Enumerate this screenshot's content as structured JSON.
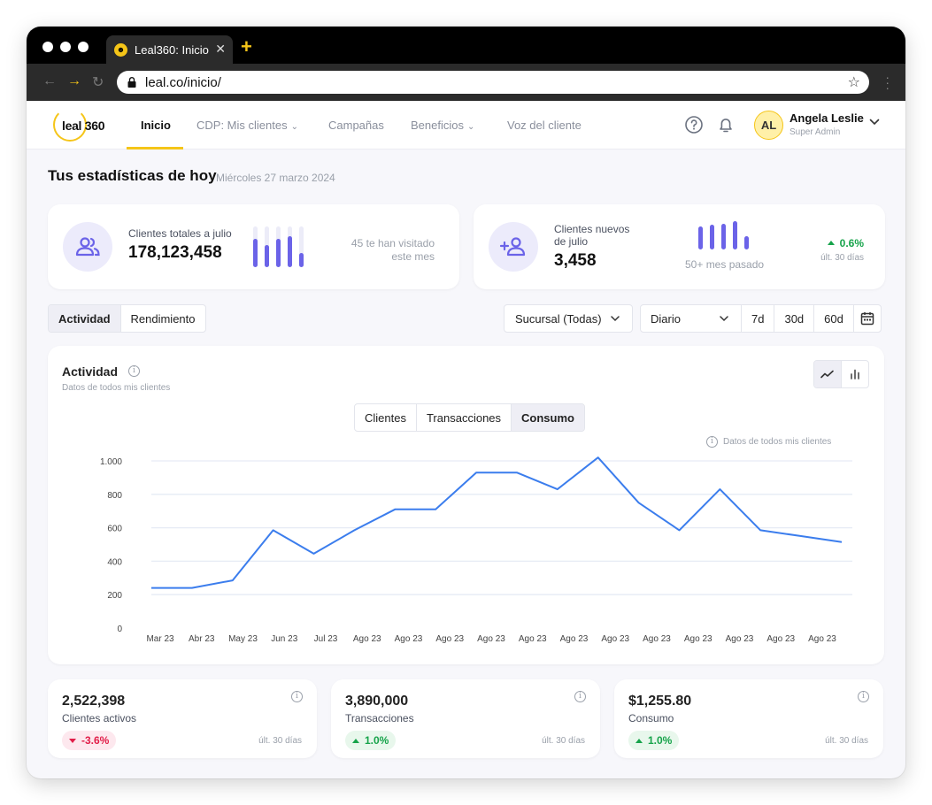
{
  "browser": {
    "tab_title": "Leal360: Inicio",
    "url": "leal.co/inicio/"
  },
  "header": {
    "logo_text": "leal 360",
    "menu": [
      {
        "label": "Inicio",
        "active": true
      },
      {
        "label": "CDP: Mis clientes",
        "dropdown": true
      },
      {
        "label": "Campañas"
      },
      {
        "label": "Beneficios",
        "dropdown": true
      },
      {
        "label": "Voz del cliente"
      }
    ],
    "user": {
      "initials": "AL",
      "name": "Angela Leslie",
      "role": "Super Admin"
    }
  },
  "page": {
    "title": "Tus estadísticas de hoy",
    "date": "Miércoles 27 marzo 2024"
  },
  "stats": {
    "total": {
      "label": "Clientes totales a julio",
      "value": "178,123,458",
      "side_note_line1": "45 te han visitado",
      "side_note_line2": "este mes",
      "bar_levels": [
        0.7,
        0.55,
        0.7,
        0.75,
        0.35
      ]
    },
    "new": {
      "label_line1": "Clientes nuevos",
      "label_line2": "de julio",
      "value": "3,458",
      "bar_caption": "50+ mes pasado",
      "delta": "0.6%",
      "period": "últ. 30 días"
    }
  },
  "controls": {
    "view_tabs": [
      {
        "label": "Actividad",
        "selected": true
      },
      {
        "label": "Rendimiento"
      }
    ],
    "branch_select": "Sucursal (Todas)",
    "granularity_select": "Diario",
    "ranges": [
      "7d",
      "30d",
      "60d"
    ]
  },
  "activity": {
    "title": "Actividad",
    "subtitle": "Datos de todos mis clientes",
    "metric_tabs": [
      {
        "label": "Clientes"
      },
      {
        "label": "Transacciones"
      },
      {
        "label": "Consumo",
        "selected": true
      }
    ],
    "note": "Datos de todos mis clientes"
  },
  "chart_data": {
    "type": "line",
    "categories": [
      "Mar 23",
      "Abr 23",
      "May 23",
      "Jun 23",
      "Jul 23",
      "Ago 23",
      "Ago 23",
      "Ago 23",
      "Ago 23",
      "Ago 23",
      "Ago 23",
      "Ago 23",
      "Ago 23",
      "Ago 23",
      "Ago 23",
      "Ago 23",
      "Ago 23"
    ],
    "values": [
      240,
      240,
      285,
      585,
      445,
      585,
      710,
      710,
      930,
      930,
      830,
      1020,
      750,
      585,
      830,
      585,
      550,
      515
    ],
    "yticks": [
      "0",
      "200",
      "400",
      "600",
      "800",
      "1.000"
    ],
    "ylim": [
      0,
      1000
    ],
    "grid": true,
    "color": "#3b7ded"
  },
  "kpis": [
    {
      "value": "2,522,398",
      "label": "Clientes activos",
      "delta": "-3.6%",
      "direction": "down",
      "period": "últ. 30 días"
    },
    {
      "value": "3,890,000",
      "label": "Transacciones",
      "delta": "1.0%",
      "direction": "up",
      "period": "últ. 30 días"
    },
    {
      "value": "$1,255.80",
      "label": "Consumo",
      "delta": "1.0%",
      "direction": "up",
      "period": "últ. 30 días"
    }
  ]
}
